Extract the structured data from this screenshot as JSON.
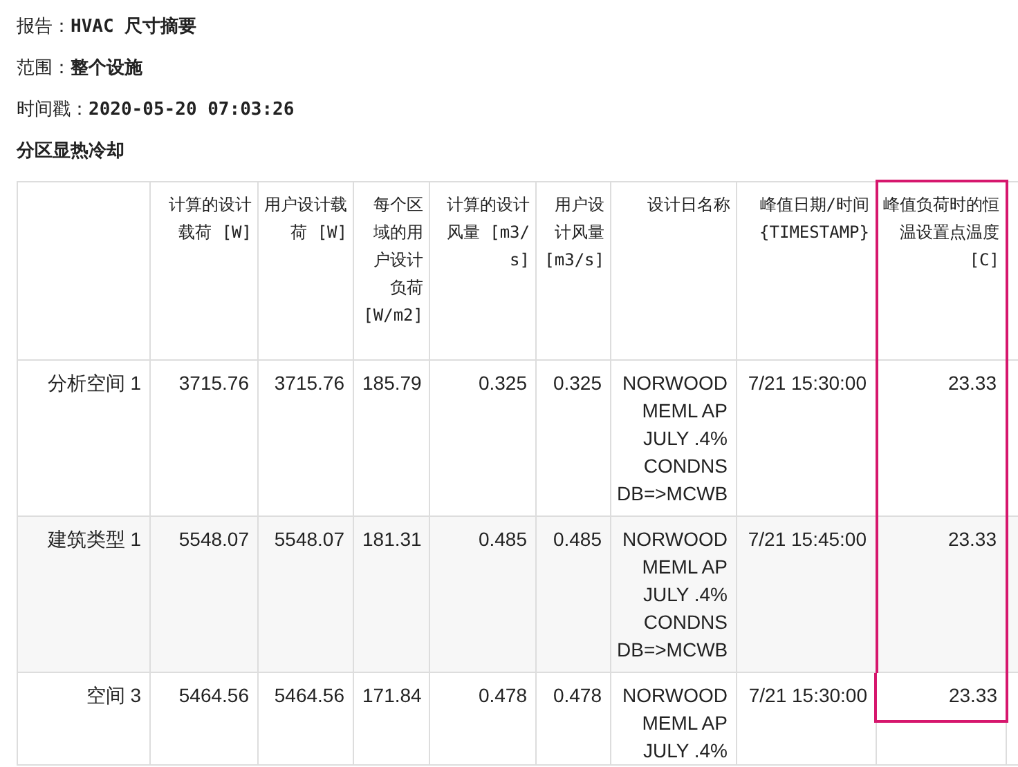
{
  "report_lines": [
    {
      "label": "报告：",
      "value": "HVAC 尺寸摘要"
    },
    {
      "label": "范围：",
      "value": "整个设施"
    },
    {
      "label": "时间戳：",
      "value": "2020-05-20 07:03:26"
    }
  ],
  "section_title": "分区显热冷却",
  "table": {
    "columns": [
      {
        "highlighted": false
      },
      {
        "label": "计算的设计载荷 [W]",
        "highlighted": false
      },
      {
        "label": "用户设计载荷 [W]",
        "highlighted": false
      },
      {
        "label": "每个区域的用户设计负荷 [W/m2]",
        "highlighted": false
      },
      {
        "label": "计算的设计风量 [m3/s]",
        "highlighted": false
      },
      {
        "label": "用户设计风量 [m3/s]",
        "highlighted": false
      },
      {
        "label": "设计日名称",
        "highlighted": false
      },
      {
        "label": "峰值日期/时间 {TIMESTAMP}",
        "highlighted": false
      },
      {
        "label": "峰值负荷时的恒温设置点温度 [C]",
        "highlighted": true
      }
    ],
    "rows": [
      {
        "cells": [
          "分析空间 1",
          "3715.76",
          "3715.76",
          "185.79",
          "0.325",
          "0.325",
          "NORWOOD MEML AP JULY .4% CONDNS DB=>MCWB",
          "7/21 15:30:00",
          "23.33"
        ]
      },
      {
        "cells": [
          "建筑类型 1",
          "5548.07",
          "5548.07",
          "181.31",
          "0.485",
          "0.485",
          "NORWOOD MEML AP JULY .4% CONDNS DB=>MCWB",
          "7/21 15:45:00",
          "23.33"
        ]
      },
      {
        "cells": [
          "空间 3",
          "5464.56",
          "5464.56",
          "171.84",
          "0.478",
          "0.478",
          "NORWOOD MEML AP JULY .4%",
          "7/21 15:30:00",
          "23.33"
        ]
      }
    ]
  }
}
